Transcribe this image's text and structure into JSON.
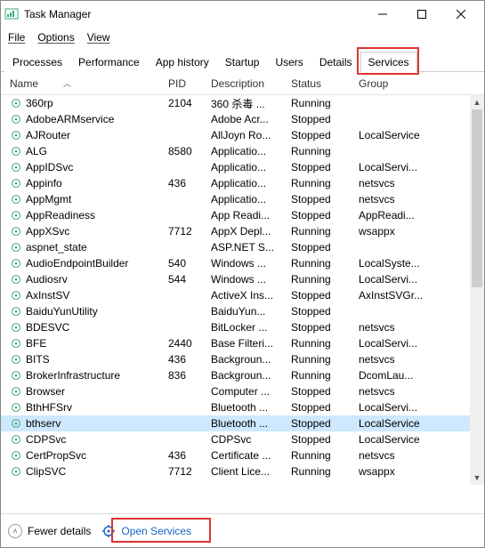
{
  "window": {
    "title": "Task Manager"
  },
  "menu": {
    "file": "File",
    "options": "Options",
    "view": "View"
  },
  "tabs": {
    "items": [
      "Processes",
      "Performance",
      "App history",
      "Startup",
      "Users",
      "Details",
      "Services"
    ],
    "active": 6,
    "highlight_index": 6
  },
  "columns": {
    "name": "Name",
    "pid": "PID",
    "desc": "Description",
    "status": "Status",
    "group": "Group"
  },
  "rows": [
    {
      "name": "360rp",
      "pid": "2104",
      "desc": "360 杀毒 ...",
      "status": "Running",
      "group": ""
    },
    {
      "name": "AdobeARMservice",
      "pid": "",
      "desc": "Adobe Acr...",
      "status": "Stopped",
      "group": ""
    },
    {
      "name": "AJRouter",
      "pid": "",
      "desc": "AllJoyn Ro...",
      "status": "Stopped",
      "group": "LocalService"
    },
    {
      "name": "ALG",
      "pid": "8580",
      "desc": "Applicatio...",
      "status": "Running",
      "group": ""
    },
    {
      "name": "AppIDSvc",
      "pid": "",
      "desc": "Applicatio...",
      "status": "Stopped",
      "group": "LocalServi..."
    },
    {
      "name": "Appinfo",
      "pid": "436",
      "desc": "Applicatio...",
      "status": "Running",
      "group": "netsvcs"
    },
    {
      "name": "AppMgmt",
      "pid": "",
      "desc": "Applicatio...",
      "status": "Stopped",
      "group": "netsvcs"
    },
    {
      "name": "AppReadiness",
      "pid": "",
      "desc": "App Readi...",
      "status": "Stopped",
      "group": "AppReadi..."
    },
    {
      "name": "AppXSvc",
      "pid": "7712",
      "desc": "AppX Depl...",
      "status": "Running",
      "group": "wsappx"
    },
    {
      "name": "aspnet_state",
      "pid": "",
      "desc": "ASP.NET S...",
      "status": "Stopped",
      "group": ""
    },
    {
      "name": "AudioEndpointBuilder",
      "pid": "540",
      "desc": "Windows ...",
      "status": "Running",
      "group": "LocalSyste..."
    },
    {
      "name": "Audiosrv",
      "pid": "544",
      "desc": "Windows ...",
      "status": "Running",
      "group": "LocalServi..."
    },
    {
      "name": "AxInstSV",
      "pid": "",
      "desc": "ActiveX Ins...",
      "status": "Stopped",
      "group": "AxInstSVGr..."
    },
    {
      "name": "BaiduYunUtility",
      "pid": "",
      "desc": "BaiduYun...",
      "status": "Stopped",
      "group": ""
    },
    {
      "name": "BDESVC",
      "pid": "",
      "desc": "BitLocker ...",
      "status": "Stopped",
      "group": "netsvcs"
    },
    {
      "name": "BFE",
      "pid": "2440",
      "desc": "Base Filteri...",
      "status": "Running",
      "group": "LocalServi..."
    },
    {
      "name": "BITS",
      "pid": "436",
      "desc": "Backgroun...",
      "status": "Running",
      "group": "netsvcs"
    },
    {
      "name": "BrokerInfrastructure",
      "pid": "836",
      "desc": "Backgroun...",
      "status": "Running",
      "group": "DcomLau..."
    },
    {
      "name": "Browser",
      "pid": "",
      "desc": "Computer ...",
      "status": "Stopped",
      "group": "netsvcs"
    },
    {
      "name": "BthHFSrv",
      "pid": "",
      "desc": "Bluetooth ...",
      "status": "Stopped",
      "group": "LocalServi..."
    },
    {
      "name": "bthserv",
      "pid": "",
      "desc": "Bluetooth ...",
      "status": "Stopped",
      "group": "LocalService",
      "selected": true
    },
    {
      "name": "CDPSvc",
      "pid": "",
      "desc": "CDPSvc",
      "status": "Stopped",
      "group": "LocalService"
    },
    {
      "name": "CertPropSvc",
      "pid": "436",
      "desc": "Certificate ...",
      "status": "Running",
      "group": "netsvcs"
    },
    {
      "name": "ClipSVC",
      "pid": "7712",
      "desc": "Client Lice...",
      "status": "Running",
      "group": "wsappx"
    }
  ],
  "footer": {
    "fewer": "Fewer details",
    "open": "Open Services"
  }
}
